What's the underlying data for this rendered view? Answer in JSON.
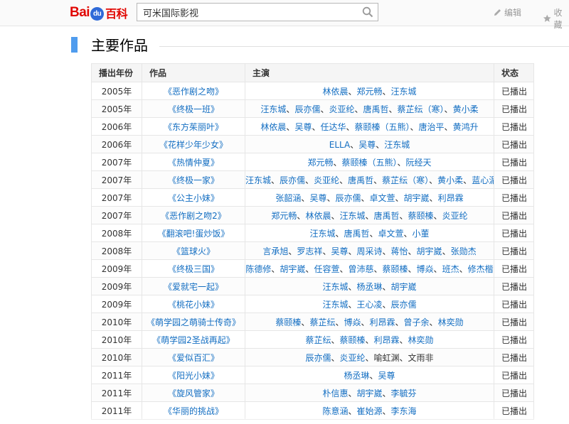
{
  "header": {
    "logo_bai": "Bai",
    "logo_du": "du",
    "logo_baike": "百科",
    "search_value": "可米国际影视",
    "edit_label": "编辑",
    "favorite_label": "收藏"
  },
  "section": {
    "title": "主要作品"
  },
  "table": {
    "headers": [
      "播出年份",
      "作品",
      "主演",
      "状态"
    ],
    "rows": [
      {
        "year": "2005年",
        "work": "《恶作剧之吻》",
        "cast": [
          "林依晨",
          "郑元畅",
          "汪东城"
        ],
        "status": "已播出"
      },
      {
        "year": "2005年",
        "work": "《终极一班》",
        "cast": [
          "汪东城",
          "辰亦儒",
          "炎亚纶",
          "唐禹哲",
          "蔡芷纭（寒）",
          "黄小柔"
        ],
        "status": "已播出"
      },
      {
        "year": "2006年",
        "work": "《东方茱丽叶》",
        "cast": [
          "林依晨",
          "吴尊",
          "任达华",
          "蔡颐榛（五熊）",
          "唐治平",
          "黄鸿升"
        ],
        "status": "已播出"
      },
      {
        "year": "2006年",
        "work": "《花样少年少女》",
        "cast": [
          "ELLA",
          "吴尊",
          "汪东城"
        ],
        "status": "已播出"
      },
      {
        "year": "2007年",
        "work": "《热情仲夏》",
        "cast": [
          "郑元畅",
          "蔡颐榛（五熊）",
          "阮经天"
        ],
        "status": "已播出"
      },
      {
        "year": "2007年",
        "work": "《终极一家》",
        "cast": [
          "汪东城",
          "辰亦儒",
          "炎亚纶",
          "唐禹哲",
          "蔡芷纭（寒）",
          "黄小柔",
          "蓝心湄"
        ],
        "status": "已播出"
      },
      {
        "year": "2007年",
        "work": "《公主小妹》",
        "cast": [
          "张韶涵",
          "吴尊",
          "辰亦儒",
          "卓文萱",
          "胡宇崴",
          "利昂霖"
        ],
        "status": "已播出"
      },
      {
        "year": "2007年",
        "work": "《恶作剧之吻2》",
        "cast": [
          "郑元畅",
          "林依晨",
          "汪东城",
          "唐禹哲",
          "蔡颐榛",
          "炎亚纶"
        ],
        "status": "已播出"
      },
      {
        "year": "2008年",
        "work": "《翻滚吧!蛋炒饭》",
        "cast": [
          "汪东城",
          "唐禹哲",
          "卓文萱",
          "小董"
        ],
        "status": "已播出"
      },
      {
        "year": "2008年",
        "work": "《篮球火》",
        "cast": [
          "言承旭",
          "罗志祥",
          "吴尊",
          "周采诗",
          "蒋怡",
          "胡宇崴",
          "张勋杰"
        ],
        "status": "已播出"
      },
      {
        "year": "2009年",
        "work": "《终极三国》",
        "cast": [
          "陈德修",
          "胡宇崴",
          "任容萱",
          "曾沛慈",
          "蔡颐榛",
          "博焱",
          "班杰",
          "修杰楷"
        ],
        "status": "已播出"
      },
      {
        "year": "2009年",
        "work": "《爱就宅一起》",
        "cast": [
          "汪东城",
          "杨丞琳",
          "胡宇崴"
        ],
        "status": "已播出"
      },
      {
        "year": "2009年",
        "work": "《桃花小妹》",
        "cast": [
          "汪东城",
          "王心凌",
          "辰亦儒"
        ],
        "status": "已播出"
      },
      {
        "year": "2010年",
        "work": "《萌学园之萌骑士传奇》",
        "cast": [
          "蔡颐榛",
          "蔡芷纭",
          "博焱",
          "利昂霖",
          "曾子余",
          "林奕勋"
        ],
        "status": "已播出"
      },
      {
        "year": "2010年",
        "work": "《萌学园2圣战再起》",
        "cast": [
          "蔡芷纭",
          "蔡颐榛",
          "利昂霖",
          "林奕勋"
        ],
        "status": "已播出"
      },
      {
        "year": "2010年",
        "work": "《爱似百汇》",
        "cast": [
          "辰亦儒",
          "炎亚纶",
          "喻虹渊",
          "文雨非"
        ],
        "plain_cast": [
          "喻虹渊",
          "文雨非"
        ],
        "status": "已播出"
      },
      {
        "year": "2011年",
        "work": "《阳光小妹》",
        "cast": [
          "杨丞琳",
          "吴尊"
        ],
        "status": "已播出"
      },
      {
        "year": "2011年",
        "work": "《旋风管家》",
        "cast": [
          "朴信惠",
          "胡宇崴",
          "李毓芬"
        ],
        "status": "已播出"
      },
      {
        "year": "2011年",
        "work": "《华丽的挑战》",
        "cast": [
          "陈意涵",
          "崔始源",
          "李东海"
        ],
        "status": "已播出"
      }
    ]
  },
  "colors": {
    "link": "#136ec2",
    "accent_bar": "#4f9cee",
    "logo_red": "#e10601",
    "logo_blue": "#2f6ad8"
  }
}
